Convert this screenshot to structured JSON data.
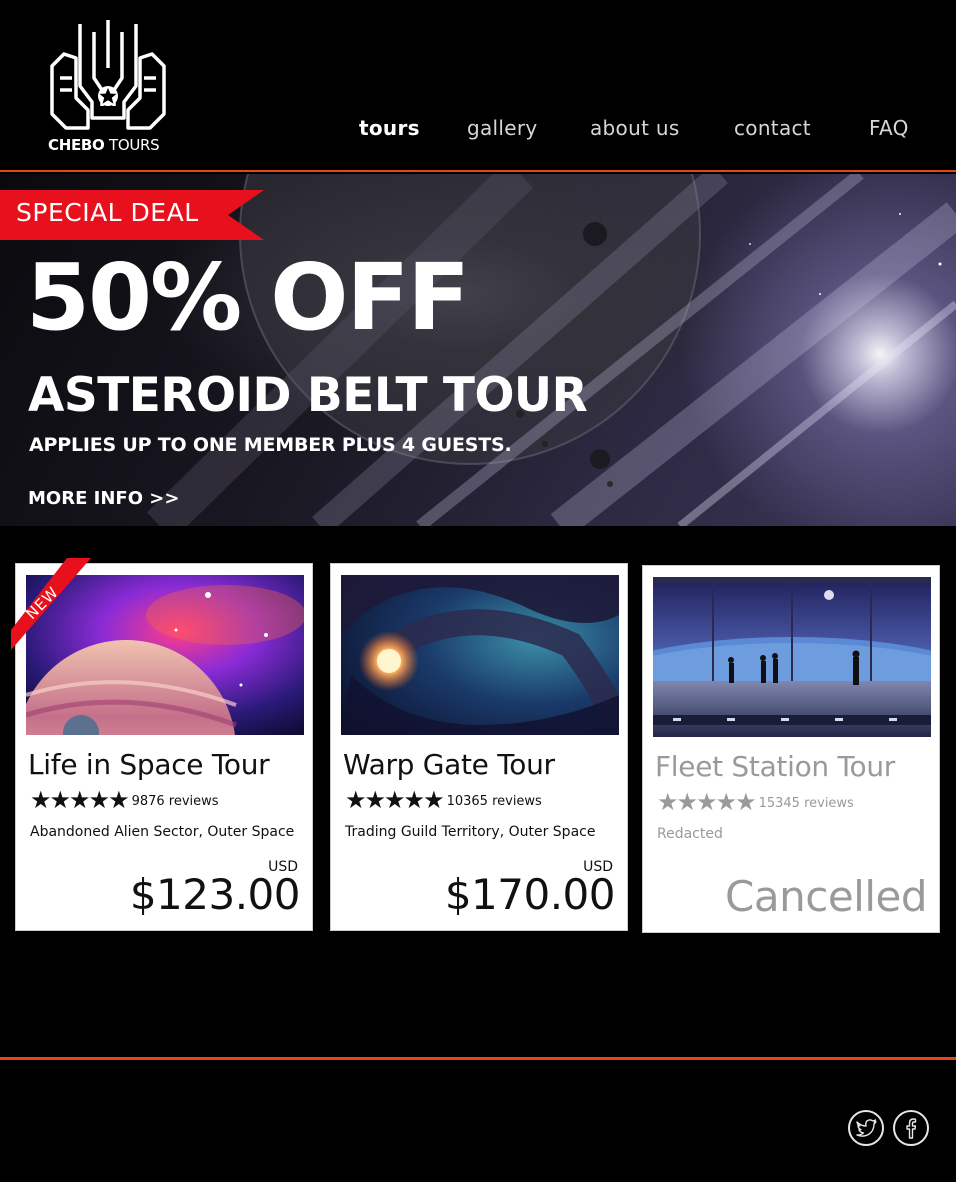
{
  "brand": {
    "name_bold": "CHEBO",
    "name_light": "TOURS"
  },
  "nav": {
    "items": [
      {
        "label": "tours",
        "active": true
      },
      {
        "label": "gallery",
        "active": false
      },
      {
        "label": "about us",
        "active": false
      },
      {
        "label": "contact",
        "active": false
      },
      {
        "label": "FAQ",
        "active": false
      }
    ]
  },
  "hero": {
    "badge": "SPECIAL DEAL",
    "discount": "50% OFF",
    "title": "ASTEROID BELT TOUR",
    "subtitle": "APPLIES UP TO ONE MEMBER PLUS 4 GUESTS.",
    "cta": "MORE INFO >>"
  },
  "tours": [
    {
      "badge": "NEW",
      "title": "Life in Space Tour",
      "stars": "★★★★★",
      "rating": 5,
      "reviews": "9876 reviews",
      "location": "Abandoned Alien Sector, Outer Space",
      "currency": "USD",
      "price": "$123.00"
    },
    {
      "title": "Warp Gate Tour",
      "stars": "★★★★★",
      "rating": 5,
      "reviews": "10365 reviews",
      "location": "Trading Guild Territory, Outer Space",
      "currency": "USD",
      "price": "$170.00"
    },
    {
      "title": "Fleet Station Tour",
      "stars": "★★★★★",
      "rating": 5,
      "reviews": "15345 reviews",
      "location": "Redacted",
      "status": "Cancelled"
    }
  ],
  "footer": {
    "social": [
      {
        "icon": "twitter-icon"
      },
      {
        "icon": "facebook-icon"
      }
    ]
  },
  "colors": {
    "accent": "#e8441c",
    "ribbon_red": "#e8101c",
    "background": "#000000",
    "card_bg": "#ffffff",
    "muted_text": "#9a9a9a"
  }
}
